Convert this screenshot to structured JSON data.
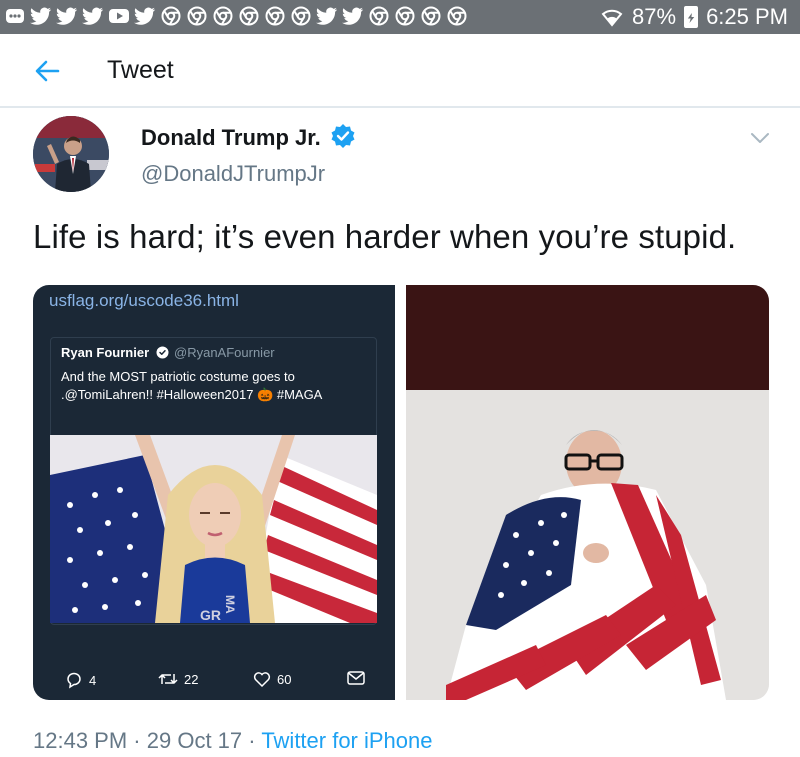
{
  "status_bar": {
    "notification_icons": [
      "more-icon",
      "twitter-icon",
      "twitter-icon",
      "twitter-icon",
      "youtube-icon",
      "twitter-icon",
      "chrome-icon",
      "chrome-icon",
      "chrome-icon",
      "chrome-icon",
      "chrome-icon",
      "chrome-icon",
      "twitter-icon",
      "twitter-icon",
      "chrome-icon",
      "chrome-icon",
      "chrome-icon",
      "chrome-icon"
    ],
    "battery_percent": "87%",
    "time": "6:25 PM"
  },
  "header": {
    "title": "Tweet",
    "accent_color": "#1da1f2"
  },
  "author": {
    "name": "Donald Trump Jr.",
    "handle": "@DonaldJTrumpJr"
  },
  "tweet": {
    "text": "Life is hard; it’s even harder when you’re stupid.",
    "time": "12:43 PM",
    "separator": "·",
    "date": "29 Oct 17",
    "source": "Twitter for iPhone"
  },
  "media_left": {
    "url": "usflag.org/uscode36.html",
    "embedded_tweet": {
      "name": "Ryan Fournier",
      "handle": "@RyanAFournier",
      "text": "And the MOST patriotic costume goes to .@TomiLahren!! #Halloween2017 🎃 #MAGA"
    },
    "actions": {
      "replies": "4",
      "retweets": "22",
      "likes": "60"
    }
  }
}
